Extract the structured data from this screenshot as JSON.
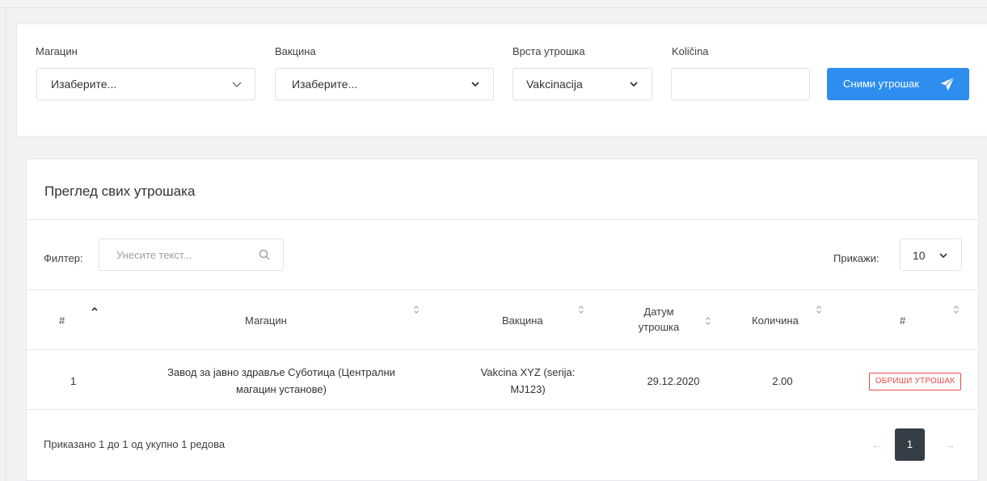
{
  "form": {
    "warehouse": {
      "label": "Магацин",
      "value": "Изаберите..."
    },
    "vaccine": {
      "label": "Вакцина",
      "value": "Изаберите..."
    },
    "consumption_type": {
      "label": "Врста утрошка",
      "value": "Vakcinacija"
    },
    "quantity": {
      "label": "Količina",
      "value": ""
    },
    "submit_label": "Сними утрошак"
  },
  "table_card": {
    "title": "Преглед свих утрошака",
    "filter_label": "Филтер:",
    "filter_placeholder": "Унесите текст...",
    "show_label": "Прикажи:",
    "page_size": "10",
    "columns": {
      "num": "#",
      "warehouse": "Магацин",
      "vaccine": "Вакцина",
      "date_line1": "Датум",
      "date_line2": "утрошка",
      "quantity": "Количина",
      "actions": "#"
    },
    "rows": [
      {
        "num": "1",
        "warehouse_line1": "Завод за јавно здравље Суботица (Централни",
        "warehouse_line2": "магацин установе)",
        "vaccine_line1": "Vakcina XYZ (serija:",
        "vaccine_line2": "MJ123)",
        "date": "29.12.2020",
        "quantity": "2.00",
        "action_label": "ОБРИШИ УТРОШАК"
      }
    ],
    "footer_text": "Приказано 1 до 1 од укупно 1 редова",
    "pagination": {
      "prev": "←",
      "current": "1",
      "next": "→"
    }
  },
  "colors": {
    "accent": "#2d8ef0",
    "danger": "#e84a4a",
    "dark": "#353d47"
  },
  "icons": {
    "dropdown": "chevron-down-icon",
    "submit": "paper-plane-icon",
    "search": "search-icon",
    "sort": "sort-icon",
    "sort_active": "sort-up-icon"
  }
}
